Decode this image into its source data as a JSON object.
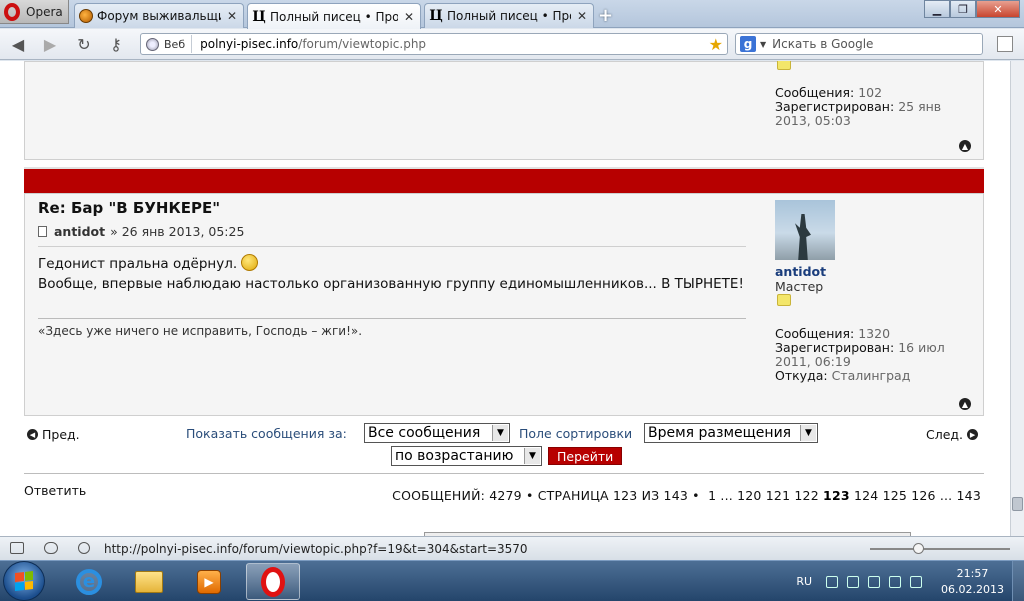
{
  "browser": {
    "menu_label": "Opera",
    "tabs": [
      {
        "label": "Форум выживальщик...",
        "active": false
      },
      {
        "label": "Полный писец • Прос...",
        "active": true
      },
      {
        "label": "Полный писец • Прос...",
        "active": false
      }
    ],
    "address": {
      "badge": "Веб",
      "url_host": "polnyi-pisec.info",
      "url_path": "/forum/viewtopic.php"
    },
    "search_placeholder": "Искать в Google"
  },
  "prev_post": {
    "messages_label": "Сообщения:",
    "messages_value": "102",
    "registered_label": "Зарегистрирован:",
    "registered_value_1": "25 янв",
    "registered_value_2": "2013, 05:03"
  },
  "post": {
    "title": "Re: Бар \"В БУНКЕРЕ\"",
    "author": "antidot",
    "date": "» 26 янв 2013, 05:25",
    "line1": "Гедонист пральна одёрнул.",
    "line2": "Вообще, впервые наблюдаю настолько организованную группу единомышленников... В ТЫРНЕТЕ!",
    "signature": "«Здесь уже ничего не исправить, Господь – жги!».",
    "profile": {
      "name": "antidot",
      "rank": "Мастер",
      "messages_label": "Сообщения:",
      "messages_value": "1320",
      "registered_label": "Зарегистрирован:",
      "registered_value_1": "16 июл",
      "registered_value_2": "2011, 06:19",
      "from_label": "Откуда:",
      "from_value": "Сталинград"
    }
  },
  "nav": {
    "prev": "Пред.",
    "next": "След.",
    "show_label": "Показать сообщения за:",
    "show_value": "Все сообщения",
    "sort_label": "Поле сортировки",
    "sort_value": "Время размещения",
    "order_value": "по возрастанию",
    "go": "Перейти"
  },
  "footer": {
    "reply": "Ответить",
    "count_text": "СООБЩЕНИЙ: 4279 • СТРАНИЦА 123 ИЗ 143 •",
    "pages_before": "1 ... 120 121 122",
    "current_page": "123",
    "pages_after": "124 125 126 ... 143"
  },
  "statusbar": {
    "url": "http://polnyi-pisec.info/forum/viewtopic.php?f=19&t=304&start=3570",
    "zoom_fraction": 0.33
  },
  "taskbar": {
    "lang": "RU",
    "time": "21:57",
    "date": "06.02.2013"
  },
  "colors": {
    "accent_red": "#b70000",
    "link_blue": "#1a3d7c",
    "opera_red": "#e01212"
  }
}
